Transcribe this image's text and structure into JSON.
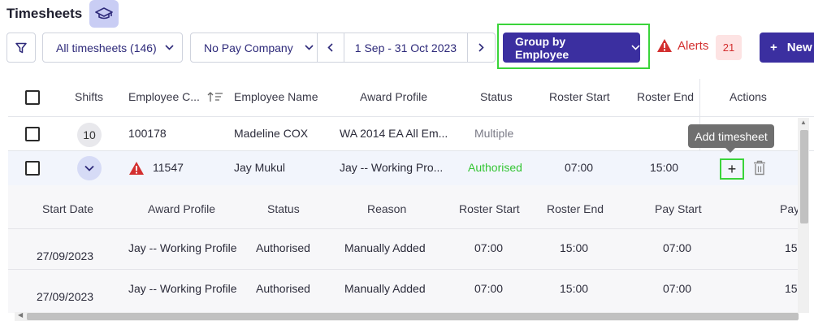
{
  "page": {
    "title": "Timesheets"
  },
  "toolbar": {
    "all_timesheets": "All timesheets (146)",
    "pay_company": "No Pay Company",
    "date_range": "1 Sep - 31 Oct 2023",
    "group_by": "Group by Employee",
    "alerts_label": "Alerts",
    "alerts_count": "21",
    "new_label": "New"
  },
  "table": {
    "columns": [
      "Shifts",
      "Employee C...",
      "Employee Name",
      "Award Profile",
      "Status",
      "Roster Start",
      "Roster End",
      "Actions"
    ],
    "rows": [
      {
        "shifts": "10",
        "employee_code": "100178",
        "employee_name": "Madeline COX",
        "award_profile": "WA 2014 EA All Em...",
        "status": "Multiple",
        "roster_start": "",
        "roster_end": ""
      },
      {
        "shifts": "",
        "employee_code": "11547",
        "employee_name": "Jay Mukul",
        "award_profile": "Jay -- Working Pro...",
        "status": "Authorised",
        "roster_start": "07:00",
        "roster_end": "15:00"
      }
    ],
    "tooltip": "Add timesheet"
  },
  "subtable": {
    "columns": [
      "Start Date",
      "Award Profile",
      "Status",
      "Reason",
      "Roster Start",
      "Roster End",
      "Pay Start",
      "Pay"
    ],
    "rows": [
      {
        "start_date": "27/09/2023",
        "award_profile": "Jay -- Working Profile",
        "status": "Authorised",
        "reason": "Manually Added",
        "roster_start": "07:00",
        "roster_end": "15:00",
        "pay_start": "07:00",
        "pay_end": "15"
      },
      {
        "start_date": "27/09/2023",
        "award_profile": "Jay -- Working Profile",
        "status": "Authorised",
        "reason": "Manually Added",
        "roster_start": "07:00",
        "roster_end": "15:00",
        "pay_start": "07:00",
        "pay_end": "15"
      }
    ]
  },
  "colors": {
    "brand": "#3b2fa0",
    "status_green": "#34c534",
    "alert_red": "#d32f2f",
    "highlight_frame": "#3ad43a"
  },
  "icons": [
    "graduation-cap-icon",
    "filter-icon",
    "chevron-down-icon",
    "chevron-left-icon",
    "chevron-right-icon",
    "warning-icon",
    "plus-icon",
    "trash-icon",
    "sort-icon"
  ]
}
